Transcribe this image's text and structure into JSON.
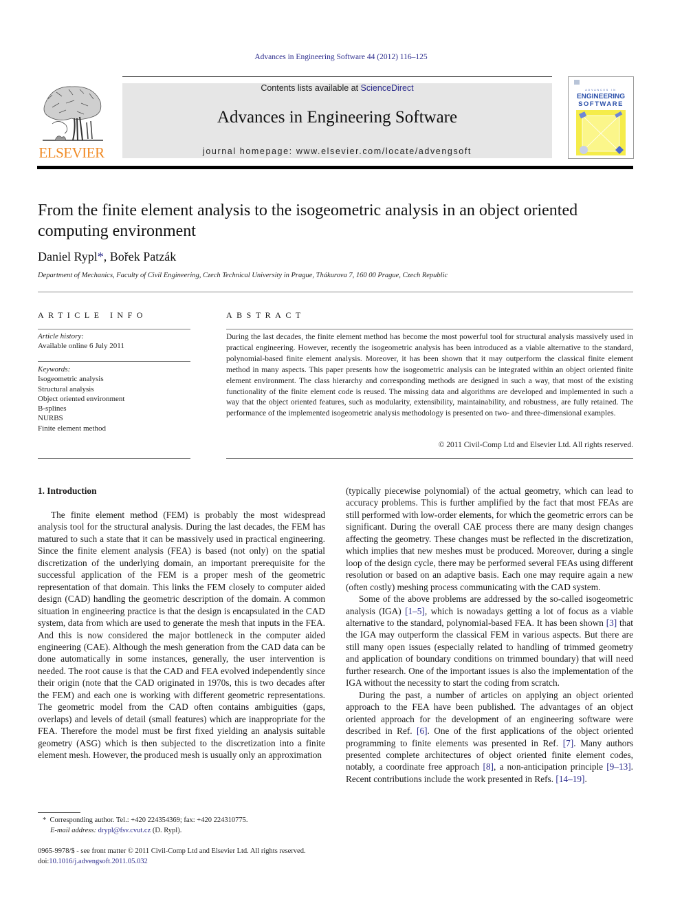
{
  "running_head": "Advances in Engineering Software 44 (2012) 116–125",
  "publisher": {
    "logo_word": "ELSEVIER",
    "logo_color": "#f08a24",
    "contents_prefix": "Contents lists available at ",
    "contents_link": "ScienceDirect",
    "journal_title": "Advances in Engineering Software",
    "homepage_prefix": "journal homepage: ",
    "homepage_url": "www.elsevier.com/locate/advengsoft",
    "link_color": "#2b2b8c"
  },
  "cover": {
    "small_caps": "ADVANCES IN",
    "line1": "ENGINEERING",
    "line2": "SOFTWARE",
    "accent": "#f5ec4a"
  },
  "article": {
    "title": "From the finite element analysis to the isogeometric analysis in an object oriented computing environment",
    "authors": [
      {
        "name": "Daniel Rypl",
        "mark": "*"
      },
      {
        "name": "Bořek Patzák",
        "mark": ""
      }
    ],
    "author_separator": ", ",
    "affiliation": "Department of Mechanics, Faculty of Civil Engineering, Czech Technical University in Prague, Thákurova 7, 160 00 Prague, Czech Republic"
  },
  "article_info": {
    "heading": "ARTICLE INFO",
    "history_label": "Article history:",
    "history_value": "Available online 6 July 2011",
    "keywords_label": "Keywords:",
    "keywords": [
      "Isogeometric analysis",
      "Structural analysis",
      "Object oriented environment",
      "B-splines",
      "NURBS",
      "Finite element method"
    ]
  },
  "abstract": {
    "heading": "ABSTRACT",
    "text": "During the last decades, the finite element method has become the most powerful tool for structural analysis massively used in practical engineering. However, recently the isogeometric analysis has been introduced as a viable alternative to the standard, polynomial-based finite element analysis. Moreover, it has been shown that it may outperform the classical finite element method in many aspects. This paper presents how the isogeometric analysis can be integrated within an object oriented finite element envi­ronment. The class hierarchy and corresponding methods are designed in such a way, that most of the existing functionality of the finite element code is reused. The missing data and algorithms are developed and implemented in such a way that the object oriented features, such as modularity, extensibility, main­tainability, and robustness, are fully retained. The performance of the implemented isogeometric analysis methodology is presented on two- and three-dimensional examples.",
    "copyright": "© 2011 Civil-Comp Ltd and Elsevier Ltd. All rights reserved."
  },
  "section": {
    "heading": "1. Introduction",
    "left_paragraphs": [
      "The finite element method (FEM) is probably the most wide­spread analysis tool for the structural analysis. During the last dec­ades, the FEM has matured to such a state that it can be massively used in practical engineering. Since the finite element analysis (FEA) is based (not only) on the spatial discretization of the under­lying domain, an important prerequisite for the successful applica­tion of the FEM is a proper mesh of the geometric representation of that domain. This links the FEM closely to computer aided design (CAD) handling the geometric description of the domain. A com­mon situation in engineering practice is that the design is encapsu­lated in the CAD system, data from which are used to generate the mesh that inputs in the FEA. And this is now considered the major bottleneck in the computer aided engineering (CAE). Although the mesh generation from the CAD data can be done automatically in some instances, generally, the user intervention is needed. The root cause is that the CAD and FEA evolved independently since their origin (note that the CAD originated in 1970s, this is two decades after the FEM) and each one is working with different geometric representations. The geometric model from the CAD often contains ambiguities (gaps, overlaps) and levels of detail (small features) which are inappropriate for the FEA. Therefore the model must be first fixed yielding an analysis suitable geometry (ASG) which is then subjected to the discretization into a finite element mesh. However, the produced mesh is usually only an approximation"
    ],
    "right_continuation": "(typically piecewise polynomial) of the actual geometry, which can lead to accuracy problems. This is further amplified by the fact that most FEAs are still performed with low-order elements, for which the geometric errors can be significant. During the overall CAE process there are many design changes affecting the geometry. These changes must be reflected in the discretization, which im­plies that new meshes must be produced. Moreover, during a sin­gle loop of the design cycle, there may be performed several FEAs using different resolution or based on an adaptive basis. Each one may require again a new (often costly) meshing process communi­cating with the CAD system.",
    "p2": {
      "a": "Some of the above problems are addressed by the so-called iso­geometric analysis (IGA) ",
      "ref1": "[1–5]",
      "b": ", which is nowadays getting a lot of focus as a viable alternative to the standard, polynomial-based FEA. It has been shown ",
      "ref2": "[3]",
      "c": " that the IGA may outperform the classical FEM in various aspects. But there are still many open issues (espe­cially related to handling of trimmed geometry and application of boundary conditions on trimmed boundary) that will need further research. One of the important issues is also the implementation of the IGA without the necessity to start the coding from scratch."
    },
    "p3": {
      "a": "During the past, a number of articles on applying an object ori­ented approach to the FEA have been published. The advantages of an object oriented approach for the development of an engineering software were described in Ref. ",
      "ref1": "[6]",
      "b": ". One of the first applications of the object oriented programming to finite elements was presented in Ref. ",
      "ref2": "[7]",
      "c": ". Many authors presented complete architectures of object oriented finite element codes, notably, a coordinate free ap­proach ",
      "ref3": "[8]",
      "d": ", a non-anticipation principle ",
      "ref4": "[9–13]",
      "e": ". Recent contribu­tions include the work presented in Refs. ",
      "ref5": "[14–19]",
      "f": "."
    }
  },
  "footnote": {
    "mark": "*",
    "line1": "Corresponding author. Tel.: +420 224354369; fax: +420 224310775.",
    "email_label": "E-mail address:",
    "email": "drypl@fsv.cvut.cz",
    "email_suffix": " (D. Rypl)."
  },
  "front_matter": {
    "line1": "0965-9978/$ - see front matter © 2011 Civil-Comp Ltd and Elsevier Ltd. All rights reserved.",
    "doi_prefix": "doi:",
    "doi": "10.1016/j.advengsoft.2011.05.032"
  }
}
